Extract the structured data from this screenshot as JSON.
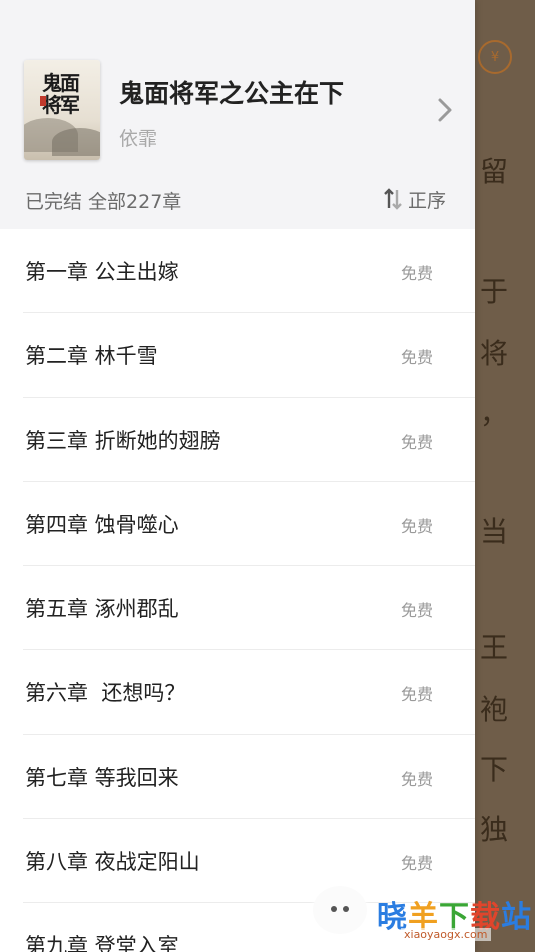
{
  "book": {
    "title": "鬼面将军之公主在下",
    "author": "依霏",
    "cover_title": "鬼面将军",
    "status_text": "已完结 全部227章"
  },
  "sort": {
    "label": "正序",
    "icon": "sort-arrows-icon"
  },
  "chapters": [
    {
      "title": "第一章 公主出嫁",
      "tag": "免费"
    },
    {
      "title": "第二章 林千雪",
      "tag": "免费"
    },
    {
      "title": "第三章 折断她的翅膀",
      "tag": "免费"
    },
    {
      "title": "第四章 蚀骨噬心",
      "tag": "免费"
    },
    {
      "title": "第五章 涿州郡乱",
      "tag": "免费"
    },
    {
      "title": "第六章  还想吗？",
      "tag": "免费"
    },
    {
      "title": "第七章 等我回来",
      "tag": "免费"
    },
    {
      "title": "第八章 夜战定阳山",
      "tag": "免费"
    },
    {
      "title": "第九章 登堂入室",
      "tag": ""
    }
  ],
  "reader_background": {
    "badge": "¥",
    "chars": [
      "留",
      "于",
      "将",
      "，",
      "当",
      "王",
      "袍",
      "下",
      "独"
    ]
  },
  "watermark": {
    "text": "晓羊下载站",
    "sub": "xiaoyaogx.com"
  },
  "colors": {
    "reader_bg": "#6f5d49",
    "header_bg": "#f4f4f6",
    "tag_gray": "#9a9a9a"
  }
}
